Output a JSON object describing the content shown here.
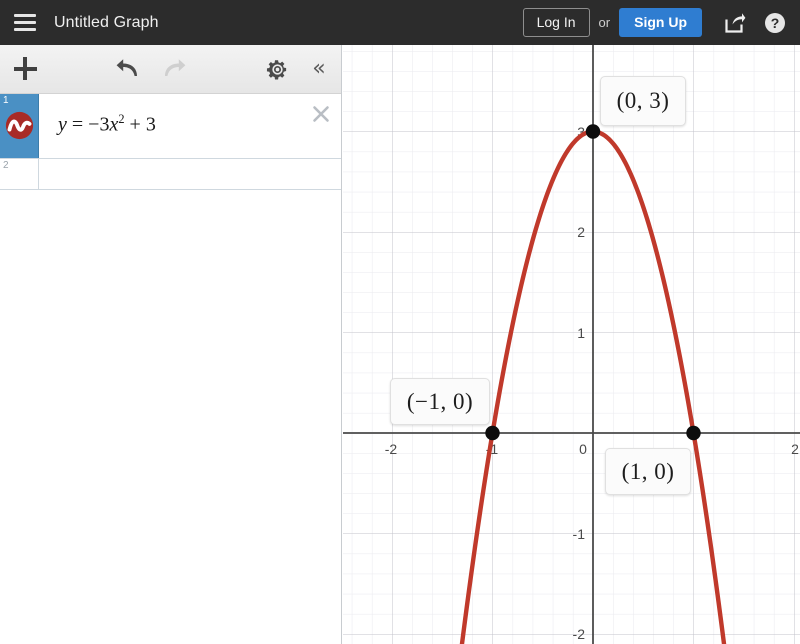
{
  "header": {
    "menu_icon": "hamburger-icon",
    "title": "Untitled Graph",
    "login_label": "Log In",
    "or_label": "or",
    "signup_label": "Sign Up",
    "share_icon": "share-icon",
    "help_icon": "question-mark-icon",
    "bg_color": "#2c2c2c",
    "signup_color": "#2f7dd1"
  },
  "panel": {
    "toolbar": {
      "add_icon": "plus-icon",
      "undo_icon": "undo-arrow-icon",
      "redo_icon": "redo-arrow-icon",
      "settings_icon": "gear-icon",
      "collapse_icon": "double-chevron-left-icon",
      "collapse_glyph": "«",
      "redo_disabled": true
    },
    "rows": [
      {
        "number": "1",
        "selected": true,
        "curve_icon": "curve-badge-icon",
        "curve_color": "#c0392b",
        "expression_lhs": "y",
        "expression_eq": "=",
        "expression_rhs_coef": "−3",
        "expression_rhs_var": "x",
        "expression_rhs_exp": "2",
        "expression_rhs_tail": "+ 3",
        "expression_plain": "y = −3x² + 3",
        "delete_icon": "close-x-icon"
      },
      {
        "number": "2",
        "selected": false,
        "expression_plain": ""
      }
    ]
  },
  "chart_data": {
    "type": "line",
    "title": "",
    "xlabel": "",
    "ylabel": "",
    "equation": "y = -3x^2 + 3",
    "curve_color": "#c0392b",
    "xlim": [
      -2.51,
      2.04
    ],
    "ylim": [
      -2.09,
      3.86
    ],
    "x_ticks": [
      "-2",
      "-1",
      "0",
      "2"
    ],
    "x_tick_values": [
      -2,
      -1,
      0,
      2
    ],
    "y_ticks": [
      "3",
      "2",
      "1",
      "-1",
      "-2"
    ],
    "y_tick_values": [
      3,
      2,
      1,
      -1,
      -2
    ],
    "grid": true,
    "minor_grid_step": 0.2,
    "major_grid_step": 1,
    "points": [
      {
        "label": "(0, 3)",
        "x": 0,
        "y": 3
      },
      {
        "label": "(−1, 0)",
        "x": -1,
        "y": 0
      },
      {
        "label": "(1, 0)",
        "x": 1,
        "y": 0
      }
    ],
    "series": [
      {
        "name": "y = -3x^2 + 3",
        "x": [
          -1.3,
          -1.1,
          -0.9,
          -0.7,
          -0.5,
          -0.3,
          -0.1,
          0,
          0.1,
          0.3,
          0.5,
          0.7,
          0.9,
          1.1,
          1.3
        ],
        "values": [
          -2.07,
          -0.63,
          0.57,
          1.53,
          2.25,
          2.73,
          2.97,
          3,
          2.97,
          2.73,
          2.25,
          1.53,
          0.57,
          -0.63,
          -2.07
        ]
      }
    ]
  },
  "graph_labels": {
    "vertex": "(0, 3)",
    "root_left": "(−1, 0)",
    "root_right": "(1, 0)"
  }
}
